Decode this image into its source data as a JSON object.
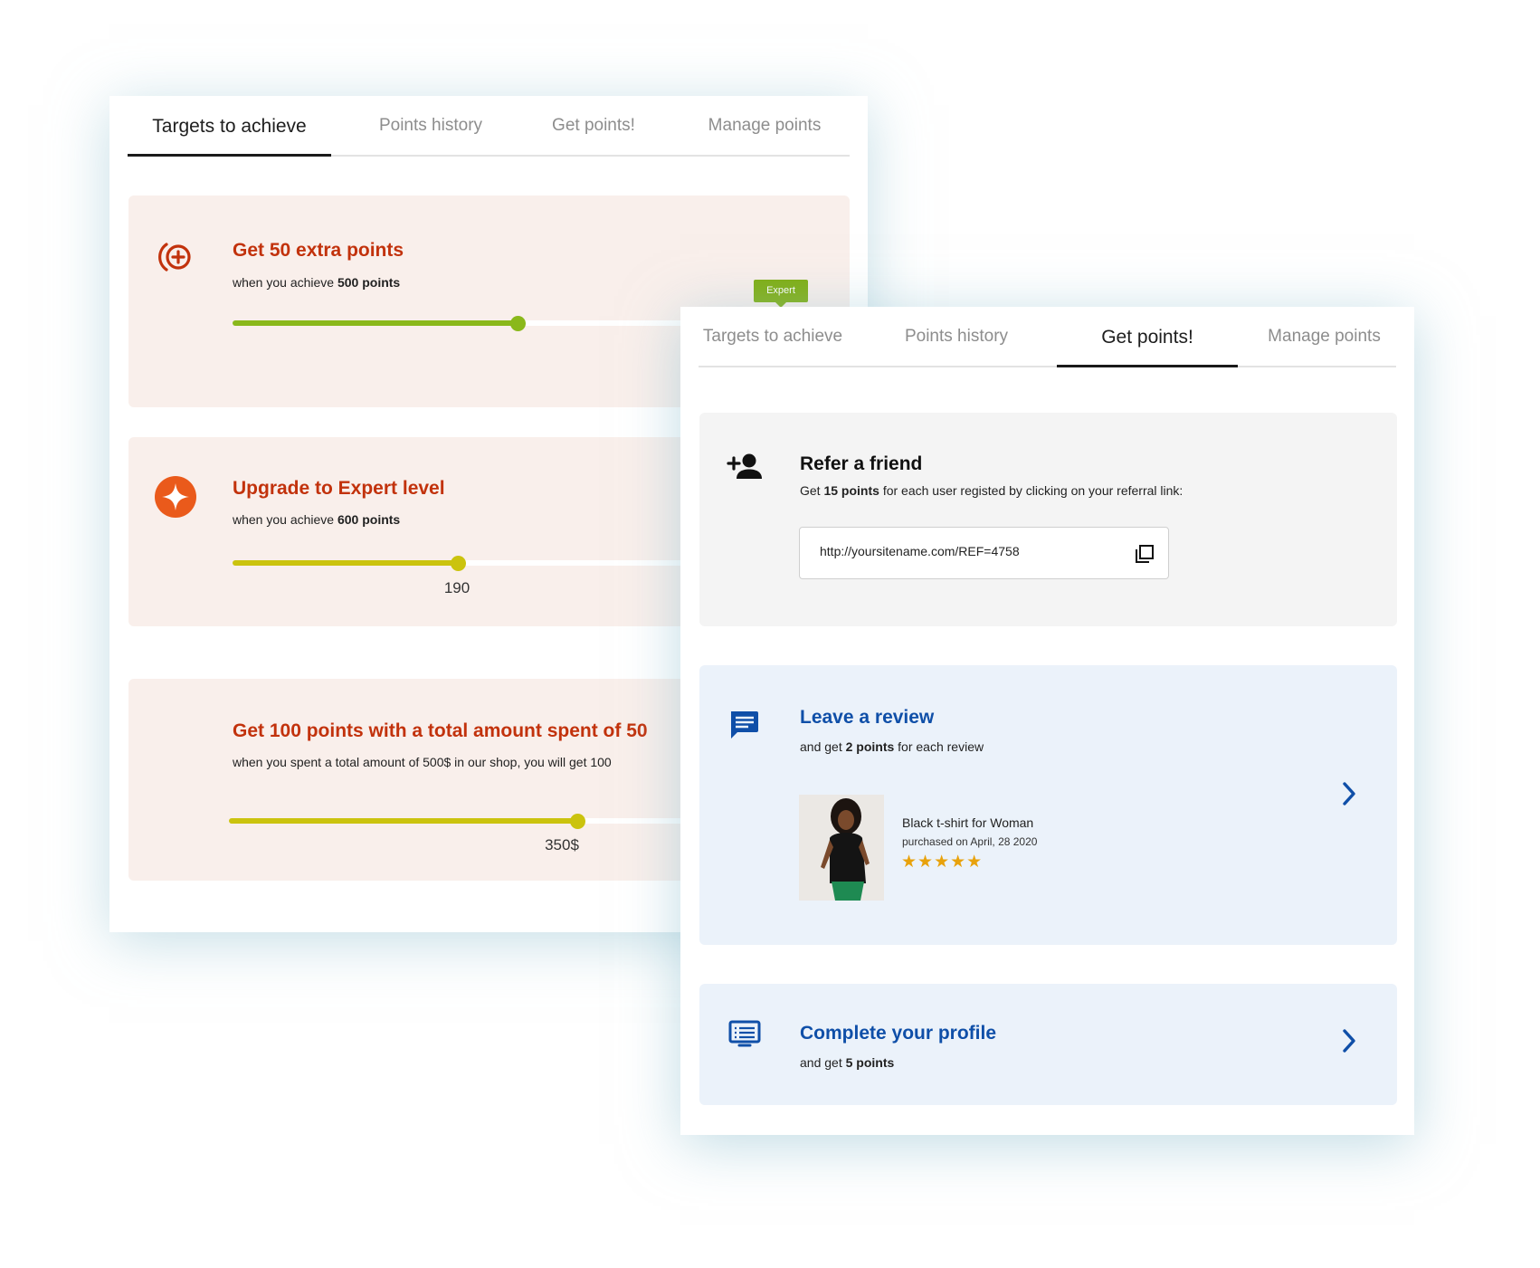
{
  "back_panel": {
    "tabs": [
      "Targets to achieve",
      "Points history",
      "Get points!",
      "Manage points"
    ],
    "active_tab": "Targets to achieve",
    "targets": [
      {
        "title": "Get 50 extra points",
        "subtitle_prefix": "when you achieve",
        "subtitle_bold": "500 points",
        "progress_color": "#8ab81b",
        "progress_fraction": 0.45,
        "flag_label": "Expert",
        "icon": "target-plus-icon"
      },
      {
        "title": "Upgrade to Expert level",
        "subtitle_prefix": "when you achieve",
        "subtitle_bold": "600 points",
        "progress_color": "#cbc30e",
        "progress_fraction": 0.355,
        "value_label": "190",
        "icon": "star-badge-icon"
      },
      {
        "title": "Get 100 points with a total amount spent of 50",
        "subtitle": "when you spent a total amount of 500$ in our shop, you will get 100",
        "progress_color": "#cbc30e",
        "progress_fraction": 0.55,
        "value_label": "350$"
      }
    ]
  },
  "front_panel": {
    "tabs": [
      "Targets to achieve",
      "Points history",
      "Get points!",
      "Manage points"
    ],
    "active_tab": "Get points!",
    "refer": {
      "title": "Refer a friend",
      "sub_prefix": "Get",
      "sub_bold": "15 points",
      "sub_suffix": "for each user registed by clicking on your referral link:",
      "link": "http://yoursitename.com/REF=4758",
      "icon": "add-user-icon"
    },
    "review": {
      "title": "Leave a review",
      "sub_prefix": "and get",
      "sub_bold": "2 points",
      "sub_suffix": "for each review",
      "product_name": "Black t-shirt for Woman",
      "purchase_date": "purchased on April, 28 2020",
      "rating": 5,
      "stars": "★★★★★",
      "icon": "chat-icon"
    },
    "profile": {
      "title": "Complete your profile",
      "sub_prefix": "and get",
      "sub_bold": "5 points",
      "icon": "profile-form-icon"
    }
  },
  "colors": {
    "target_title": "#c2320c",
    "target_card_bg": "#f9efeb",
    "accent_blue": "#0f4fa8",
    "review_card_bg": "#ebf2fa",
    "refer_card_bg": "#f4f4f4",
    "star_color": "#e8a20c",
    "badge_orange": "#ea5a1b",
    "flag_green": "#7fae12"
  }
}
